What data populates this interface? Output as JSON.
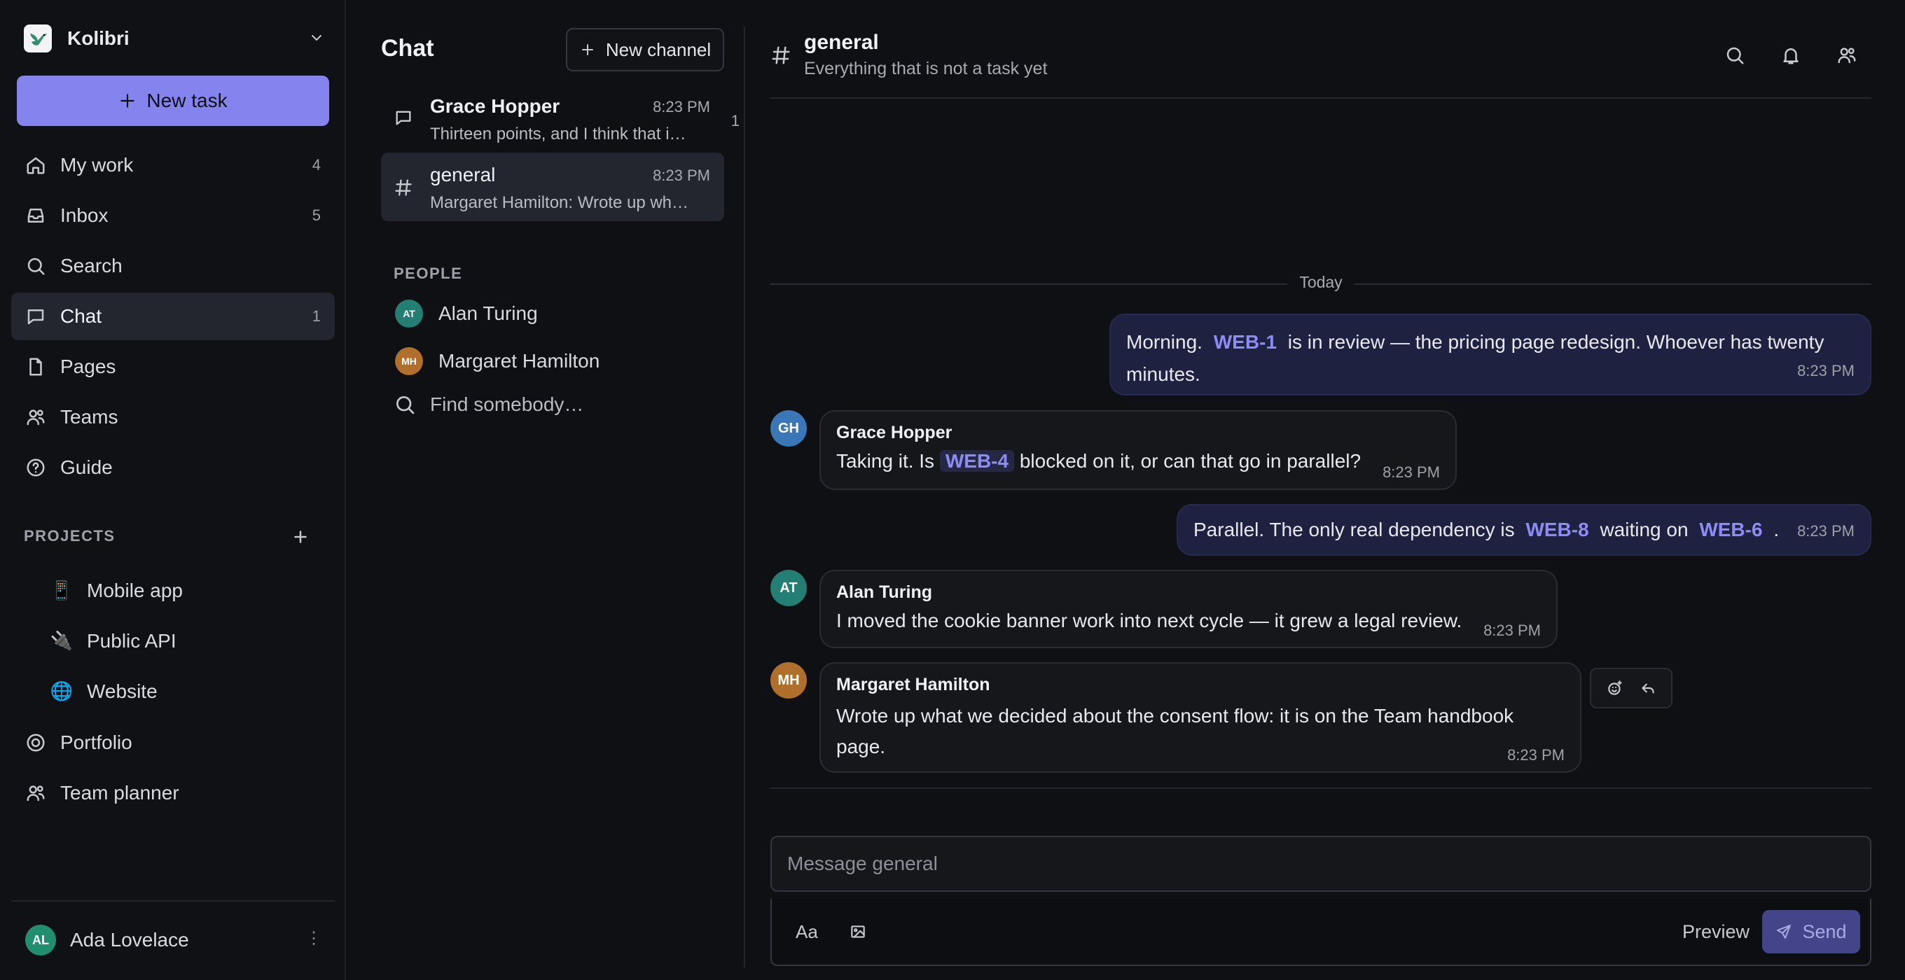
{
  "sidebar": {
    "workspace": "Kolibri",
    "new_task": "New task",
    "nav": [
      {
        "label": "My work",
        "count": "4",
        "icon": "home-icon"
      },
      {
        "label": "Inbox",
        "count": "5",
        "icon": "inbox-icon"
      },
      {
        "label": "Search",
        "count": "",
        "icon": "search-icon"
      },
      {
        "label": "Chat",
        "count": "1",
        "icon": "chat-icon"
      },
      {
        "label": "Pages",
        "count": "",
        "icon": "page-icon"
      },
      {
        "label": "Teams",
        "count": "",
        "icon": "people-icon"
      },
      {
        "label": "Guide",
        "count": "",
        "icon": "help-icon"
      }
    ],
    "projects_header": "PROJECTS",
    "projects": [
      {
        "emoji": "📱",
        "label": "Mobile app"
      },
      {
        "emoji": "🔌",
        "label": "Public API"
      },
      {
        "emoji": "🌐",
        "label": "Website"
      }
    ],
    "extra_nav": [
      {
        "label": "Portfolio",
        "icon": "portfolio-icon"
      },
      {
        "label": "Team planner",
        "icon": "people-icon"
      }
    ],
    "user": {
      "initials": "AL",
      "name": "Ada Lovelace",
      "menu": "⋮"
    }
  },
  "chatlist": {
    "title": "Chat",
    "new_channel": "New channel",
    "conversations": [
      {
        "name": "Grace Hopper",
        "time": "8:23 PM",
        "preview": "Thirteen points, and I think that is all of the things I could find.",
        "badge": "1"
      },
      {
        "name": "general",
        "time": "8:23 PM",
        "preview": "Margaret Hamilton: Wrote up what we decided about the consent flow",
        "badge": ""
      }
    ],
    "people_header": "PEOPLE",
    "people": [
      {
        "initials": "AT",
        "name": "Alan Turing"
      },
      {
        "initials": "MH",
        "name": "Margaret Hamilton"
      }
    ],
    "find": "Find somebody…"
  },
  "channel": {
    "name": "general",
    "description": "Everything that is not a task yet",
    "day": "Today",
    "messages": [
      {
        "text_a": "Morning. ",
        "tag": "WEB-1",
        "text_b": " is in review — the pricing page redesign. Whoever has twenty minutes.",
        "time": "8:23 PM"
      },
      {
        "initials": "GH",
        "author": "Grace Hopper",
        "text_a": "Taking it. Is ",
        "tag": "WEB-4",
        "text_b": " blocked on it, or can that go in parallel?",
        "time": "8:23 PM"
      },
      {
        "text_a": "Parallel. The only real dependency is ",
        "tag": "WEB-8",
        "text_b": " waiting on ",
        "tag2": "WEB-6",
        "text_c": " .",
        "time": "8:23 PM"
      },
      {
        "initials": "AT",
        "author": "Alan Turing",
        "text": "I moved the cookie banner work into next cycle — it grew a legal review.",
        "time": "8:23 PM"
      },
      {
        "initials": "MH",
        "author": "Margaret Hamilton",
        "text": "Wrote up what we decided about the consent flow: it is on the Team handbook page.",
        "time": "8:23 PM"
      }
    ],
    "composer": {
      "placeholder": "Message general",
      "format": "Aa",
      "preview": "Preview",
      "send": "Send"
    }
  },
  "colors": {
    "accent": "#8584ee",
    "tag": "#8e8cf4",
    "avatar_al": "#1f8f6f",
    "avatar_at": "#237f73",
    "avatar_mh": "#b06f2a",
    "avatar_gh": "#3a77b6"
  }
}
